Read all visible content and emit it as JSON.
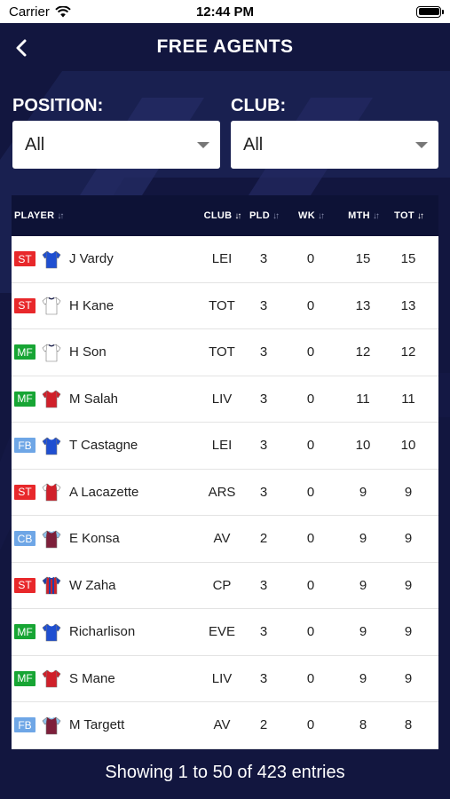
{
  "status_bar": {
    "carrier": "Carrier",
    "time": "12:44 PM"
  },
  "header": {
    "title": "FREE AGENTS"
  },
  "filters": {
    "position": {
      "label": "POSITION:",
      "value": "All"
    },
    "club": {
      "label": "CLUB:",
      "value": "All"
    }
  },
  "table": {
    "columns": [
      "PLAYER",
      "CLUB",
      "PLD",
      "WK",
      "MTH",
      "TOT"
    ],
    "rows": [
      {
        "pos": "ST",
        "name": "J Vardy",
        "club": "LEI",
        "pld": "3",
        "wk": "0",
        "mth": "15",
        "tot": "15"
      },
      {
        "pos": "ST",
        "name": "H Kane",
        "club": "TOT",
        "pld": "3",
        "wk": "0",
        "mth": "13",
        "tot": "13"
      },
      {
        "pos": "MF",
        "name": "H Son",
        "club": "TOT",
        "pld": "3",
        "wk": "0",
        "mth": "12",
        "tot": "12"
      },
      {
        "pos": "MF",
        "name": "M Salah",
        "club": "LIV",
        "pld": "3",
        "wk": "0",
        "mth": "11",
        "tot": "11"
      },
      {
        "pos": "FB",
        "name": "T Castagne",
        "club": "LEI",
        "pld": "3",
        "wk": "0",
        "mth": "10",
        "tot": "10"
      },
      {
        "pos": "ST",
        "name": "A Lacazette",
        "club": "ARS",
        "pld": "3",
        "wk": "0",
        "mth": "9",
        "tot": "9"
      },
      {
        "pos": "CB",
        "name": "E Konsa",
        "club": "AV",
        "pld": "2",
        "wk": "0",
        "mth": "9",
        "tot": "9"
      },
      {
        "pos": "ST",
        "name": "W Zaha",
        "club": "CP",
        "pld": "3",
        "wk": "0",
        "mth": "9",
        "tot": "9"
      },
      {
        "pos": "MF",
        "name": "Richarlison",
        "club": "EVE",
        "pld": "3",
        "wk": "0",
        "mth": "9",
        "tot": "9"
      },
      {
        "pos": "MF",
        "name": "S Mane",
        "club": "LIV",
        "pld": "3",
        "wk": "0",
        "mth": "9",
        "tot": "9"
      },
      {
        "pos": "FB",
        "name": "M Targett",
        "club": "AV",
        "pld": "2",
        "wk": "0",
        "mth": "8",
        "tot": "8"
      }
    ]
  },
  "footer": {
    "entries_text": "Showing 1 to 50 of 423 entries"
  },
  "colors": {
    "background": "#12163f",
    "table_header": "#0d1236",
    "pos_ST": "#e8282b",
    "pos_MF": "#17a534",
    "pos_FB": "#6ea6e6",
    "pos_CB": "#6ea6e6"
  },
  "shirt_icons": {
    "LEI": "blue-shirt-icon",
    "TOT": "white-shirt-icon",
    "LIV": "red-shirt-icon",
    "ARS": "red-white-shirt-icon",
    "AV": "claret-blue-shirt-icon",
    "CP": "red-blue-striped-shirt-icon",
    "EVE": "blue-shirt-icon"
  }
}
